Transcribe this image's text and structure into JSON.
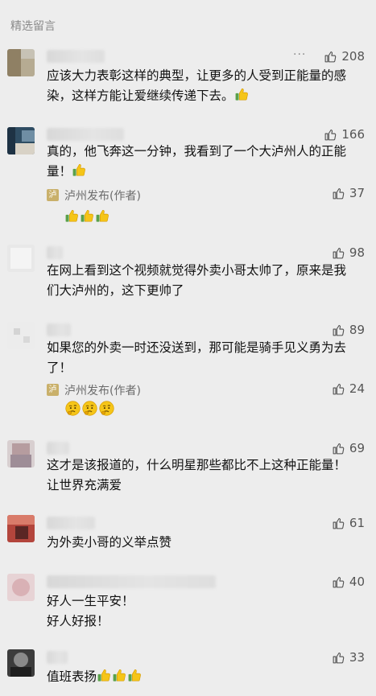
{
  "section_title": "精选留言",
  "more_label": "···",
  "comments": [
    {
      "likes": "208",
      "line1": "应该大力表彰这样的典型，让更多的人受到正能量的感",
      "line2": "染，这样方能让爱继续传递下去。",
      "has_more": true,
      "end_emoji": "thumbs-up-icon"
    },
    {
      "likes": "166",
      "line1": "真的，他飞奔这一分钟，我看到了一个大泸州人的正能",
      "line2": "量！",
      "end_emoji": "thumbs-up-icon",
      "reply": {
        "author": "泸州发布(作者)",
        "likes": "37",
        "emojis": [
          "thumbs-up-icon",
          "thumbs-up-icon",
          "thumbs-up-icon"
        ]
      }
    },
    {
      "likes": "98",
      "line1": "在网上看到这个视频就觉得外卖小哥太帅了，原来是我",
      "line2": "们大泸州的，这下更帅了"
    },
    {
      "likes": "89",
      "line1": "如果您的外卖一时还没送到，那可能是骑手见义勇为去",
      "line2": "了！",
      "reply": {
        "author": "泸州发布(作者)",
        "likes": "24",
        "emojis": [
          "thinking-face-icon",
          "thinking-face-icon",
          "thinking-face-icon"
        ]
      }
    },
    {
      "likes": "69",
      "line1": "这才是该报道的，什么明星那些都比不上这种正能量！",
      "line2": "让世界充满爱"
    },
    {
      "likes": "61",
      "line1": "为外卖小哥的义举点赞",
      "line2": ""
    },
    {
      "likes": "40",
      "line1": "好人一生平安！",
      "line2": "好人好报！"
    },
    {
      "likes": "33",
      "line1": "值班表扬",
      "line2": "",
      "end_emojis": [
        "thumbs-up-icon",
        "thumbs-up-icon",
        "thumbs-up-icon"
      ]
    }
  ],
  "colors": {
    "background": "#ededed",
    "meta_text": "#8a8a8a",
    "author_badge": "#c9b06a",
    "emoji_yellow": "#f5c518"
  }
}
